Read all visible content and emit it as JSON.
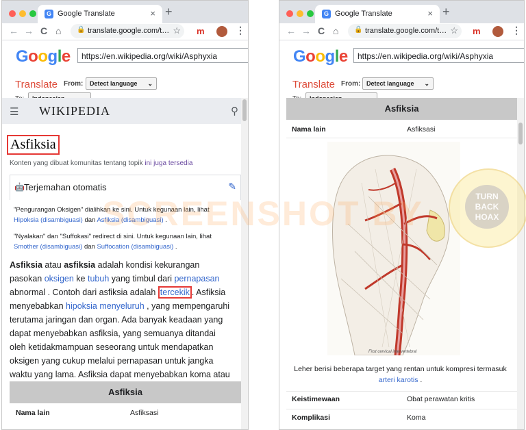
{
  "browser": {
    "tab_title": "Google Translate",
    "tab_close": "×",
    "new_tab": "+",
    "address": "translate.google.com/t…",
    "back_icon": "←",
    "forward_icon": "→",
    "reload_icon": "C",
    "home_icon": "⌂",
    "lock_icon": "🔒",
    "star_icon": "☆",
    "ext_label": "m",
    "menu_icon": "⋮"
  },
  "translate_bar": {
    "logo": [
      "G",
      "o",
      "o",
      "g",
      "l",
      "e"
    ],
    "url_value": "https://en.wikipedia.org/wiki/Asphyxia",
    "translate_label": "Translate",
    "from_label": "From:",
    "from_value": "Detect language",
    "to_label": "To:",
    "to_value": "Indonesian"
  },
  "left": {
    "wiki_logo": "WIKIPEDIA",
    "title": "Asfiksia",
    "community_text": "Konten yang dibuat komunitas tentang topik ",
    "community_link": "ini juga tersedia",
    "auto_title": "Terjemahan otomatis",
    "hat1_a": "\"Pengurangan Oksigen\" dialihkan ke sini. Untuk kegunaan lain, lihat ",
    "hat1_l1": "Hipoksia (disambiguasi)",
    "hat1_b": " dan ",
    "hat1_l2": "Asfiksia (disambiguasi)",
    "hat1_c": " .",
    "hat2_a": "\"Nyalakan\" dan \"Suffokasi\" redirect di sini. Untuk kegunaan lain, lihat ",
    "hat2_l1": "Smother (disambiguasi)",
    "hat2_b": " dan ",
    "hat2_l2": "Suffocation (disambiguasi)",
    "hat2_c": " .",
    "para": {
      "b1": "Asfiksia",
      "t1": " atau ",
      "b2": "asfiksia",
      "t2": " adalah kondisi kekurangan pasokan ",
      "l1": "oksigen",
      "t3": " ke ",
      "l2": "tubuh",
      "t4": " yang timbul dari ",
      "l3": "pernapasan",
      "t5": " abnormal . Contoh dari asfiksia adalah ",
      "l4": "tercekik",
      "t6": ". Asfiksia menyebabkan ",
      "l5": "hipoksia menyeluruh",
      "t7": " , yang mempengaruhi terutama jaringan dan organ. Ada banyak keadaan yang dapat menyebabkan asfiksia, yang semuanya ditandai oleh ketidakmampuan seseorang untuk mendapatkan oksigen yang cukup melalui pernapasan untuk jangka waktu yang lama. Asfiksia dapat menyebabkan koma atau kematian."
    },
    "infobox_title": "Asfiksia",
    "row_label": "Nama lain",
    "row_value": "Asfiksasi"
  },
  "right": {
    "infobox_title": "Asfiksia",
    "row1_label": "Nama lain",
    "row1_value": "Asfiksasi",
    "image_caption": "First cervical intervertebral",
    "caption_text": "Leher berisi beberapa target yang rentan untuk kompresi termasuk ",
    "caption_link": "arteri karotis",
    "caption_end": " .",
    "row2_label": "Keistimewaan",
    "row2_value": "Obat perawatan kritis",
    "row3_label": "Komplikasi",
    "row3_value": "Koma"
  },
  "watermark": {
    "text": "SCREENSHOT BY",
    "badge_lines": [
      "TURN",
      "BACK",
      "HOAX"
    ]
  },
  "colors": {
    "highlight_box": "#e53935",
    "link": "#3366cc",
    "translate_red": "#dd4b39"
  }
}
